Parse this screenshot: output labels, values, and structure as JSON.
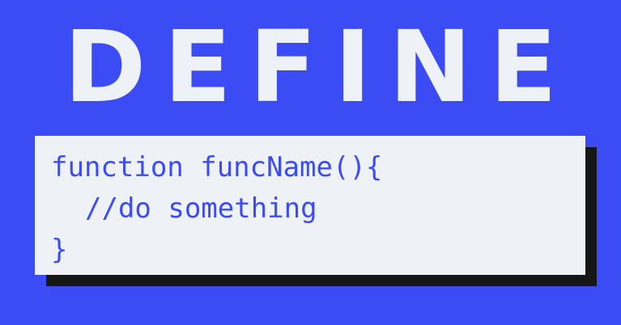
{
  "title": "DEFINE",
  "code": {
    "lines": [
      "function funcName(){",
      "//do something",
      "}"
    ]
  },
  "colors": {
    "background": "#3b4cf5",
    "panel": "#eef1f6",
    "shadow": "#161616",
    "code_text": "#3b4cf5",
    "title_text": "#eef1f6"
  }
}
